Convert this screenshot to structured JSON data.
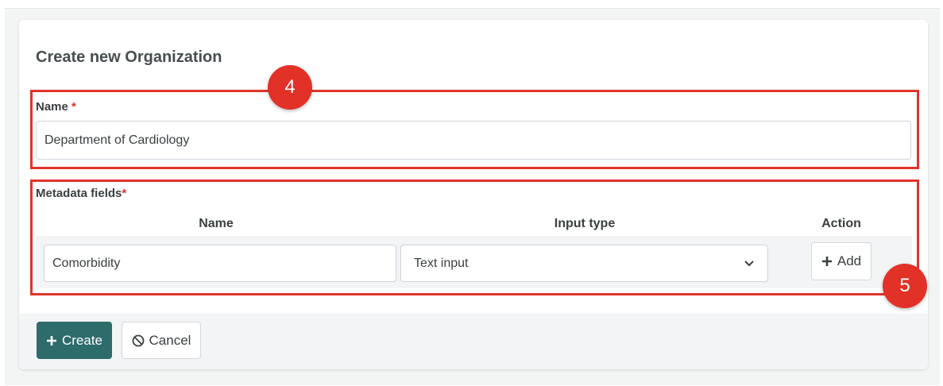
{
  "form": {
    "title": "Create new Organization",
    "name_label": "Name",
    "required_marker": "*",
    "name_value": "Department of Cardiology",
    "metadata_label": "Metadata fields",
    "columns": {
      "name": "Name",
      "input_type": "Input type",
      "action": "Action"
    },
    "row": {
      "name_value": "Comorbidity",
      "input_type_value": "Text input",
      "add_label": "Add"
    },
    "create_label": "Create",
    "cancel_label": "Cancel"
  },
  "annotations": {
    "marker_4": "4",
    "marker_5": "5"
  },
  "colors": {
    "primary": "#2e6b6b",
    "annotation_red": "#e1342a",
    "required": "#d0342c"
  }
}
